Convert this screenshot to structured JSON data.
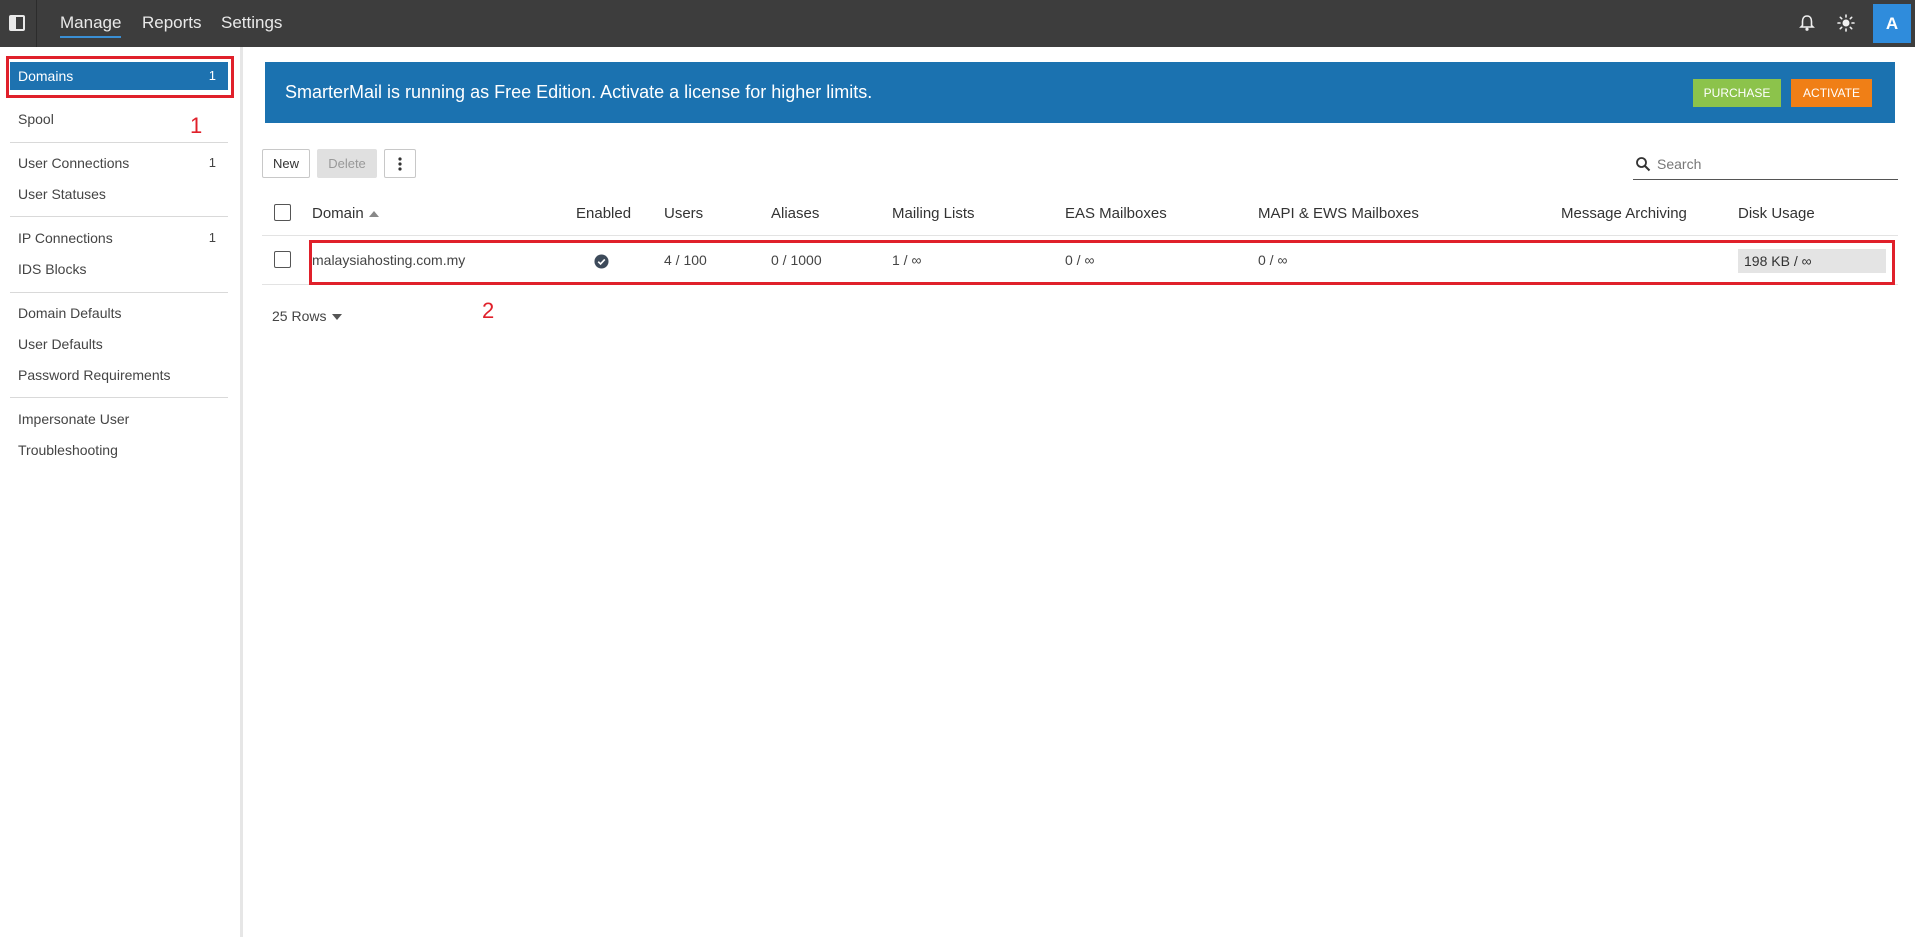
{
  "topbar": {
    "tabs": [
      {
        "label": "Manage",
        "active": true
      },
      {
        "label": "Reports",
        "active": false
      },
      {
        "label": "Settings",
        "active": false
      }
    ],
    "icons": [
      "sidebar-toggle-icon",
      "bell-icon",
      "sun-icon"
    ],
    "avatar_letter": "A"
  },
  "sidebar": {
    "items": [
      {
        "label": "Domains",
        "count": "1",
        "active": true
      },
      {
        "label": "Spool",
        "count": ""
      },
      {
        "label": "User Connections",
        "count": "1"
      },
      {
        "label": "User Statuses",
        "count": ""
      },
      {
        "label": "IP Connections",
        "count": "1"
      },
      {
        "label": "IDS Blocks",
        "count": ""
      },
      {
        "label": "Domain Defaults",
        "count": ""
      },
      {
        "label": "User Defaults",
        "count": ""
      },
      {
        "label": "Password Requirements",
        "count": ""
      },
      {
        "label": "Impersonate User",
        "count": ""
      },
      {
        "label": "Troubleshooting",
        "count": ""
      }
    ]
  },
  "annotations": {
    "one": "1",
    "two": "2"
  },
  "banner": {
    "text": "SmarterMail is running as Free Edition. Activate a license for higher limits.",
    "purchase_label": "PURCHASE",
    "activate_label": "ACTIVATE"
  },
  "toolbar": {
    "new_label": "New",
    "delete_label": "Delete",
    "more_icon": "more-vertical-icon",
    "search_placeholder": "Search"
  },
  "table": {
    "columns": [
      "Domain",
      "Enabled",
      "Users",
      "Aliases",
      "Mailing Lists",
      "EAS Mailboxes",
      "MAPI & EWS Mailboxes",
      "Message Archiving",
      "Disk Usage"
    ],
    "rows": [
      {
        "domain": "malaysiahosting.com.my",
        "enabled": true,
        "users": "4 / 100",
        "aliases": "0 / 1000",
        "mailing_lists": "1 / ∞",
        "eas": "0 / ∞",
        "mapi": "0 / ∞",
        "archiving": "",
        "disk": "198 KB / ∞",
        "disk_fraction": 0.0
      }
    ],
    "rows_per_page": "25 Rows"
  },
  "colors": {
    "topbar": "#3d3d3d",
    "accent": "#1d72b0",
    "purchase": "#8cc34b",
    "activate": "#f07f16",
    "highlight": "#e0202a"
  }
}
